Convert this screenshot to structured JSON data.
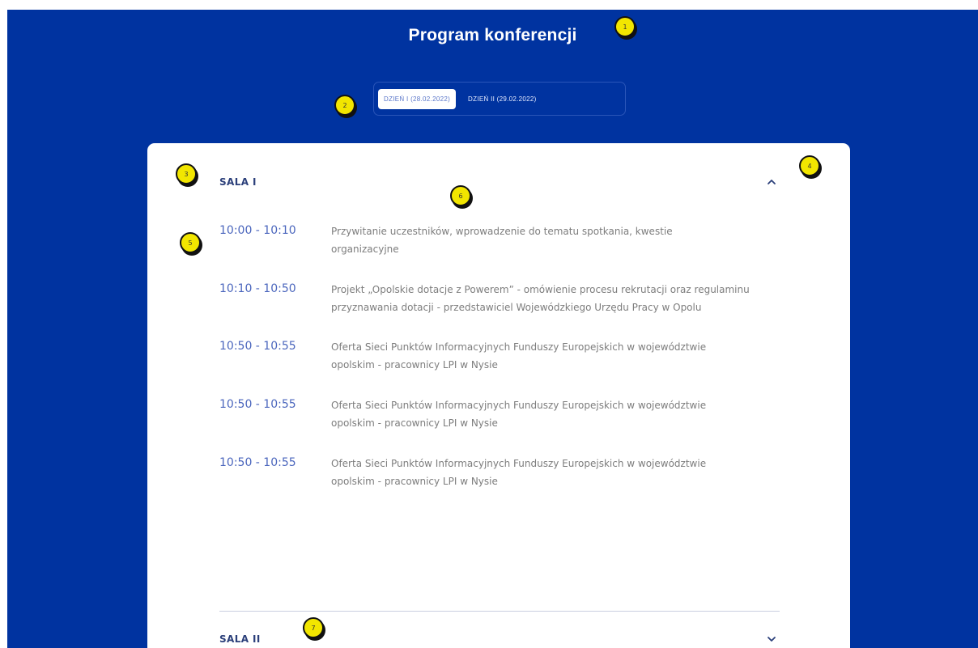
{
  "page": {
    "title": "Program konferencji"
  },
  "tabs": [
    {
      "label": "DZIEŃ I (28.02.2022)",
      "active": true
    },
    {
      "label": "DZIEŃ II (29.02.2022)",
      "active": false
    }
  ],
  "sections": [
    {
      "title": "SALA I",
      "expanded": true,
      "chevron_icon": "chevron-up-icon",
      "items": [
        {
          "time": "10:00 - 10:10",
          "description": "Przywitanie uczestników, wprowadzenie do tematu spotkania, kwestie organizacyjne"
        },
        {
          "time": "10:10 - 10:50",
          "description": "Projekt „Opolskie dotacje z Powerem” - omówienie procesu rekrutacji oraz regulaminu przyznawania dotacji - przedstawiciel Wojewódzkiego Urzędu Pracy w Opolu"
        },
        {
          "time": "10:50 - 10:55",
          "description": "Oferta Sieci Punktów Informacyjnych Funduszy Europejskich w województwie opolskim - pracownicy LPI w Nysie"
        },
        {
          "time": "10:50 - 10:55",
          "description": "Oferta Sieci Punktów Informacyjnych Funduszy Europejskich w województwie opolskim - pracownicy LPI w Nysie"
        },
        {
          "time": "10:50 - 10:55",
          "description": "Oferta Sieci Punktów Informacyjnych Funduszy Europejskich w województwie opolskim - pracownicy LPI w Nysie"
        }
      ]
    },
    {
      "title": "SALA II",
      "expanded": false,
      "chevron_icon": "chevron-down-icon"
    }
  ],
  "annotations": [
    "1",
    "2",
    "3",
    "4",
    "5",
    "6",
    "7"
  ],
  "colors": {
    "background": "#0033a0",
    "accent": "#4b66bd",
    "marker": "#f2e600"
  }
}
